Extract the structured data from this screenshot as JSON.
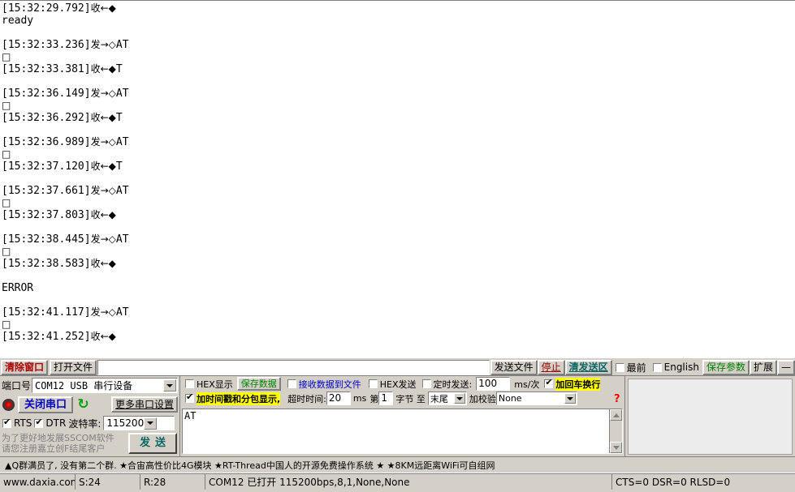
{
  "terminal": {
    "lines": [
      {
        "time": "[15:32:29.792]",
        "dir": "收←",
        "marker": "◆",
        "text": ""
      },
      {
        "time": "",
        "dir": "",
        "marker": "",
        "text": "ready"
      },
      {
        "time": "",
        "dir": "",
        "marker": "",
        "text": ""
      },
      {
        "time": "[15:32:33.236]",
        "dir": "发→",
        "marker": "◇",
        "text": "AT"
      },
      {
        "time": "",
        "dir": "",
        "marker": "□",
        "text": ""
      },
      {
        "time": "[15:32:33.381]",
        "dir": "收←",
        "marker": "◆",
        "text": "T"
      },
      {
        "time": "",
        "dir": "",
        "marker": "",
        "text": ""
      },
      {
        "time": "[15:32:36.149]",
        "dir": "发→",
        "marker": "◇",
        "text": "AT"
      },
      {
        "time": "",
        "dir": "",
        "marker": "□",
        "text": ""
      },
      {
        "time": "[15:32:36.292]",
        "dir": "收←",
        "marker": "◆",
        "text": "T"
      },
      {
        "time": "",
        "dir": "",
        "marker": "",
        "text": ""
      },
      {
        "time": "[15:32:36.989]",
        "dir": "发→",
        "marker": "◇",
        "text": "AT"
      },
      {
        "time": "",
        "dir": "",
        "marker": "□",
        "text": ""
      },
      {
        "time": "[15:32:37.120]",
        "dir": "收←",
        "marker": "◆",
        "text": "T"
      },
      {
        "time": "",
        "dir": "",
        "marker": "",
        "text": ""
      },
      {
        "time": "[15:32:37.661]",
        "dir": "发→",
        "marker": "◇",
        "text": "AT"
      },
      {
        "time": "",
        "dir": "",
        "marker": "□",
        "text": ""
      },
      {
        "time": "[15:32:37.803]",
        "dir": "收←",
        "marker": "◆",
        "text": ""
      },
      {
        "time": "",
        "dir": "",
        "marker": "",
        "text": ""
      },
      {
        "time": "[15:32:38.445]",
        "dir": "发→",
        "marker": "◇",
        "text": "AT"
      },
      {
        "time": "",
        "dir": "",
        "marker": "□",
        "text": ""
      },
      {
        "time": "[15:32:38.583]",
        "dir": "收←",
        "marker": "◆",
        "text": ""
      },
      {
        "time": "",
        "dir": "",
        "marker": "",
        "text": ""
      },
      {
        "time": "",
        "dir": "",
        "marker": "",
        "text": "ERROR"
      },
      {
        "time": "",
        "dir": "",
        "marker": "",
        "text": ""
      },
      {
        "time": "[15:32:41.117]",
        "dir": "发→",
        "marker": "◇",
        "text": "AT"
      },
      {
        "time": "",
        "dir": "",
        "marker": "□",
        "text": ""
      },
      {
        "time": "[15:32:41.252]",
        "dir": "收←",
        "marker": "◆",
        "text": ""
      }
    ]
  },
  "toolbar": {
    "clear_window": "清除窗口",
    "open_file": "打开文件",
    "file_path": "",
    "send_file": "发送文件",
    "stop": "停止",
    "clear_send": "清发送区",
    "topmost_label": "最前",
    "topmost_checked": false,
    "english_label": "English",
    "english_checked": false,
    "save_params": "保存参数",
    "extend": "扩展",
    "minus": "—"
  },
  "port": {
    "label": "端口号",
    "value": "COM12 USB 串行设备",
    "close_button": "关闭串口",
    "refresh_icon": "refresh-icon",
    "more_settings": "更多串口设置",
    "rts_label": "RTS",
    "rts_checked": true,
    "dtr_label": "DTR",
    "dtr_checked": true,
    "baud_label": "波特率:",
    "baud_value": "115200"
  },
  "promo": {
    "line1": "为了更好地发展SSCOM软件",
    "line2": "请您注册嘉立创F结尾客户",
    "send_button": "发送"
  },
  "options": {
    "hex_display_label": "HEX显示",
    "hex_display_checked": false,
    "save_data": "保存数据",
    "recv_to_file_label": "接收数据到文件",
    "recv_to_file_checked": false,
    "hex_send_label": "HEX发送",
    "hex_send_checked": false,
    "timed_send_label": "定时发送:",
    "timed_send_checked": false,
    "timed_send_value": "100",
    "ms_per": "ms/次",
    "crlf_label": "加回车换行",
    "crlf_checked": true,
    "timestamp_label": "加时间戳和分包显示,",
    "timestamp_checked": true,
    "timeout_label": "超时时间:",
    "timeout_value": "20",
    "ms_unit": "ms",
    "byte_prefix": "第",
    "byte_index": "1",
    "byte_label": "字节 至",
    "byte_end": "末尾",
    "checksum_label": "加校验",
    "checksum_value": "None",
    "help_icon": "question-mark-icon"
  },
  "send_area": {
    "text": "AT"
  },
  "adbar": {
    "text": "▲Q群满员了, 没有第二个群. ★合宙高性价比4G模块  ★RT-Thread中国人的开源免费操作系统  ★  ★8KM远距离WiFi可自组网"
  },
  "statusbar": {
    "website": "www.daxia.com",
    "sent": "S:24",
    "received": "R:28",
    "connection": "COM12 已打开  115200bps,8,1,None,None",
    "signals": "CTS=0 DSR=0 RLSD=0"
  },
  "colors": {
    "face": "#d4d0c8",
    "highlight": "#ffff00",
    "red": "#aa0000",
    "green": "#008000",
    "teal": "#006666",
    "blue": "#0000cc"
  }
}
